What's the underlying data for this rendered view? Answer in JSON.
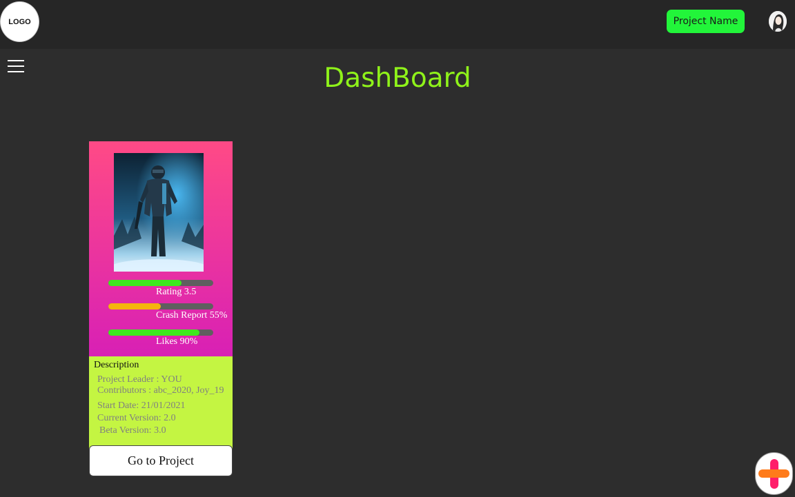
{
  "header": {
    "logo_text": "LOGO",
    "project_button_label": "Project Name",
    "avatar_icon": "user-avatar",
    "accent_color": "#22f53a"
  },
  "menu": {
    "icon": "hamburger-menu-icon"
  },
  "page": {
    "title": "DashBoard",
    "title_color": "#8ff21a",
    "background": "#2d2d2d"
  },
  "card": {
    "image_alt": "game cover - soldier",
    "stats": [
      {
        "label": "Rating 3.5",
        "fraction": 0.7,
        "color": "#3ee81e"
      },
      {
        "label": "Crash Report 55%",
        "fraction": 0.5,
        "color": "#f5b40e"
      },
      {
        "label": "Likes 90%",
        "fraction": 0.87,
        "color": "#3ee81e"
      }
    ],
    "description": {
      "title": "Description",
      "project_leader": "Project Leader : YOU",
      "contributors": "Contributors : abc_2020, Joy_19",
      "start_date": "Start Date: 21/01/2021",
      "current_version": "Current Version: 2.0",
      "beta_version": "Beta Version: 3.0"
    },
    "button_label": "Go to Project"
  },
  "fab": {
    "icon": "plus-icon"
  }
}
